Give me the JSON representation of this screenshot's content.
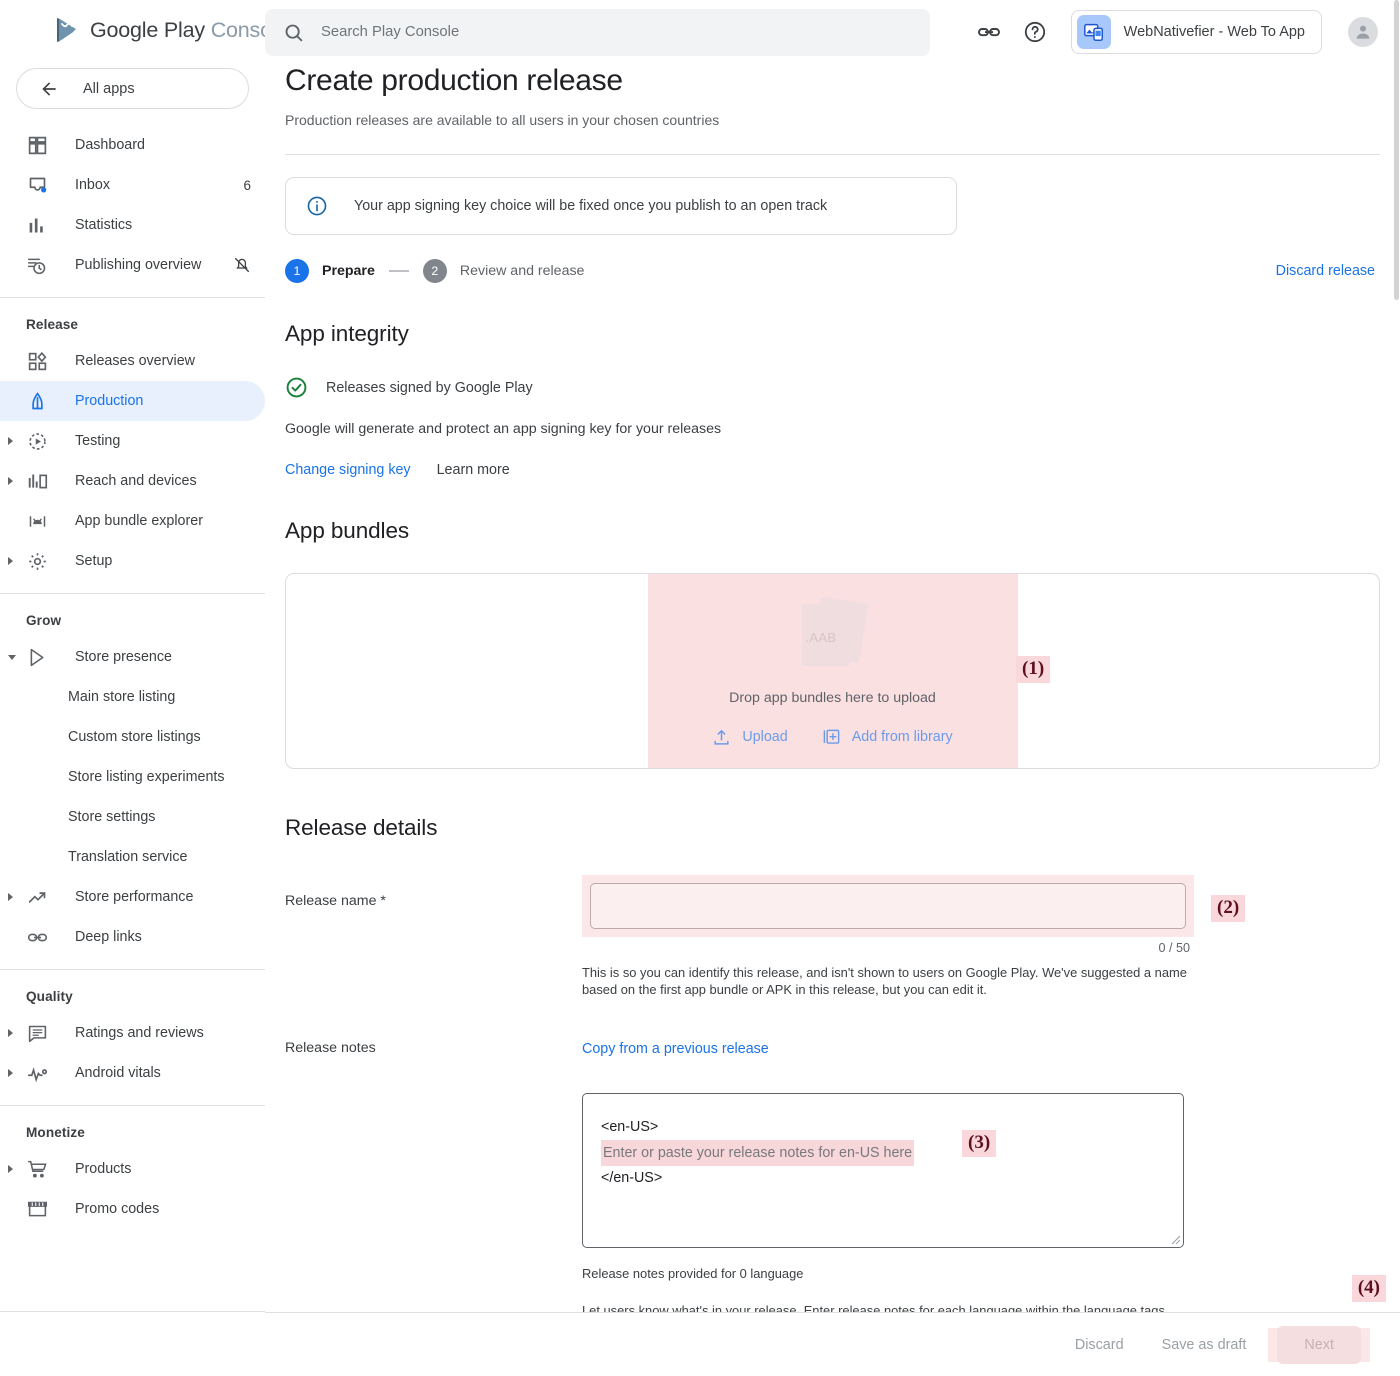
{
  "brand": {
    "name_primary": "Google Play",
    "name_secondary": "Console"
  },
  "sidebar": {
    "all_apps_label": "All apps",
    "primary_items": [
      {
        "label": "Dashboard",
        "icon": "dashboard-icon",
        "badge": ""
      },
      {
        "label": "Inbox",
        "icon": "inbox-icon",
        "badge": "6"
      },
      {
        "label": "Statistics",
        "icon": "statistics-icon",
        "badge": ""
      },
      {
        "label": "Publishing overview",
        "icon": "publishing-overview-icon",
        "badge": ""
      }
    ],
    "groups": [
      {
        "title": "Release",
        "items": [
          {
            "label": "Releases overview",
            "icon": "releases-overview-icon",
            "active": false,
            "expandable": false,
            "sub": false
          },
          {
            "label": "Production",
            "icon": "production-icon",
            "active": true,
            "expandable": false,
            "sub": false
          },
          {
            "label": "Testing",
            "icon": "testing-icon",
            "active": false,
            "expandable": true,
            "sub": false
          },
          {
            "label": "Reach and devices",
            "icon": "reach-devices-icon",
            "active": false,
            "expandable": true,
            "sub": false
          },
          {
            "label": "App bundle explorer",
            "icon": "app-bundle-explorer-icon",
            "active": false,
            "expandable": false,
            "sub": false
          },
          {
            "label": "Setup",
            "icon": "setup-gear-icon",
            "active": false,
            "expandable": true,
            "sub": false
          }
        ]
      },
      {
        "title": "Grow",
        "items": [
          {
            "label": "Store presence",
            "icon": "store-presence-icon",
            "active": false,
            "expandable": true,
            "expanded": true,
            "sub": false
          },
          {
            "label": "Main store listing",
            "icon": "",
            "active": false,
            "expandable": false,
            "sub": true
          },
          {
            "label": "Custom store listings",
            "icon": "",
            "active": false,
            "expandable": false,
            "sub": true
          },
          {
            "label": "Store listing experiments",
            "icon": "",
            "active": false,
            "expandable": false,
            "sub": true
          },
          {
            "label": "Store settings",
            "icon": "",
            "active": false,
            "expandable": false,
            "sub": true
          },
          {
            "label": "Translation service",
            "icon": "",
            "active": false,
            "expandable": false,
            "sub": true
          },
          {
            "label": "Store performance",
            "icon": "store-performance-icon",
            "active": false,
            "expandable": true,
            "sub": false
          },
          {
            "label": "Deep links",
            "icon": "deep-links-icon",
            "active": false,
            "expandable": false,
            "sub": false
          }
        ]
      },
      {
        "title": "Quality",
        "items": [
          {
            "label": "Ratings and reviews",
            "icon": "ratings-reviews-icon",
            "active": false,
            "expandable": true,
            "sub": false
          },
          {
            "label": "Android vitals",
            "icon": "android-vitals-icon",
            "active": false,
            "expandable": true,
            "sub": false
          }
        ]
      },
      {
        "title": "Monetize",
        "items": [
          {
            "label": "Products",
            "icon": "products-cart-icon",
            "active": false,
            "expandable": true,
            "sub": false
          },
          {
            "label": "Promo codes",
            "icon": "promo-codes-icon",
            "active": false,
            "expandable": false,
            "sub": false
          }
        ]
      }
    ]
  },
  "topbar": {
    "search_placeholder": "Search Play Console",
    "search_value": "",
    "app_name": "WebNativefier - Web To App"
  },
  "page": {
    "title": "Create production release",
    "subtitle": "Production releases are available to all users in your chosen countries",
    "info_banner": "Your app signing key choice will be fixed once you publish to an open track",
    "discard_release_label": "Discard release",
    "steps": [
      {
        "number": "1",
        "label": "Prepare",
        "state": "active"
      },
      {
        "number": "2",
        "label": "Review and release",
        "state": "inactive"
      }
    ]
  },
  "app_integrity": {
    "heading": "App integrity",
    "signed_status": "Releases signed by Google Play",
    "description": "Google will generate and protect an app signing key for your releases",
    "change_key_label": "Change signing key",
    "learn_more_label": "Learn more"
  },
  "app_bundles": {
    "heading": "App bundles",
    "file_badge": ".AAB",
    "drop_text": "Drop app bundles here to upload",
    "upload_label": "Upload",
    "add_from_library_label": "Add from library"
  },
  "release_details": {
    "heading": "Release details",
    "release_name_label": "Release name  *",
    "release_name_value": "",
    "release_name_counter": "0 / 50",
    "release_name_help": "This is so you can identify this release, and isn't shown to users on Google Play. We've suggested a name based on the first app bundle or APK in this release, but you can edit it.",
    "release_notes_label": "Release notes",
    "copy_previous_label": "Copy from a previous release",
    "notes_open_tag": "<en-US>",
    "notes_placeholder": "Enter or paste your release notes for en-US here",
    "notes_close_tag": "</en-US>",
    "notes_count_text": "Release notes provided for 0 language",
    "notes_hint": "Let users know what's in your release. Enter release notes for each language within the language tags."
  },
  "bottom_bar": {
    "discard_label": "Discard",
    "save_draft_label": "Save as draft",
    "next_label": "Next"
  },
  "annotations": [
    {
      "id": "1",
      "text": "(1)"
    },
    {
      "id": "2",
      "text": "(2)"
    },
    {
      "id": "3",
      "text": "(3)"
    },
    {
      "id": "4",
      "text": "(4)"
    }
  ],
  "colors": {
    "accent_blue": "#1a73e8",
    "active_nav_bg": "#e8f0fe",
    "highlight_pink": "#fbe0e2",
    "annotation_pink": "#f9d7da",
    "success_green": "#188038"
  }
}
